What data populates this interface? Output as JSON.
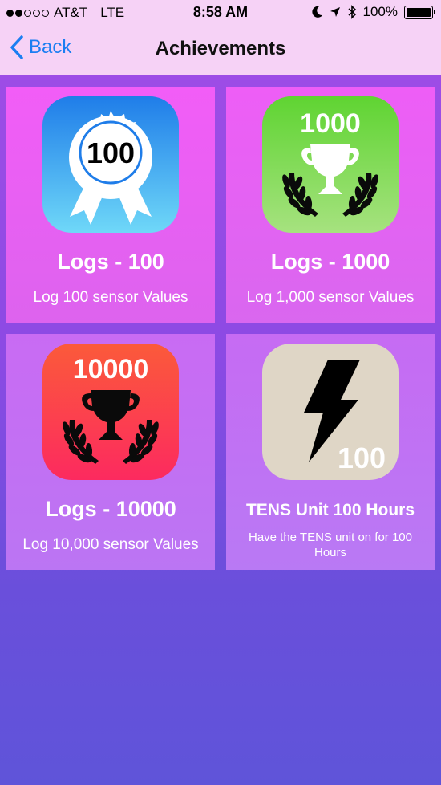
{
  "status_bar": {
    "carrier": "AT&T",
    "network": "LTE",
    "time": "8:58 AM",
    "battery": "100%"
  },
  "nav": {
    "back_label": "Back",
    "title": "Achievements"
  },
  "achievements": [
    {
      "badge": "100",
      "title": "Logs - 100",
      "description": "Log 100 sensor Values"
    },
    {
      "badge": "1000",
      "title": "Logs - 1000",
      "description": "Log 1,000 sensor Values"
    },
    {
      "badge": "10000",
      "title": "Logs - 10000",
      "description": "Log 10,000 sensor Values"
    },
    {
      "badge": "100",
      "title": "TENS Unit 100 Hours",
      "description": "Have the TENS unit on for 100 Hours"
    }
  ],
  "colors": {
    "link": "#1b7ef2",
    "bar": "#f6d2f6"
  }
}
